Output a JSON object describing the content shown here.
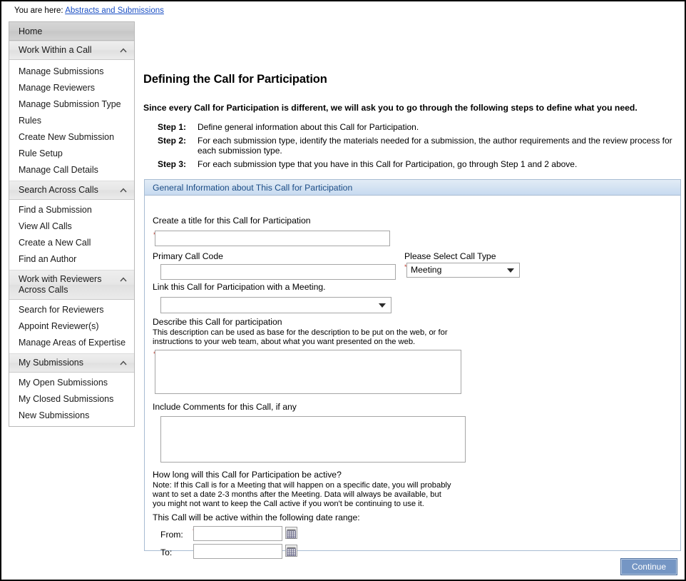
{
  "breadcrumb": {
    "label": "You are here:",
    "link": "Abstracts and Submissions"
  },
  "sidebar": {
    "home": "Home",
    "groups": [
      {
        "header": "Work Within a Call",
        "chevron_icon": "chevron-up-icon",
        "items": [
          "Manage Submissions",
          "Manage Reviewers",
          "Manage Submission Type",
          "Rules",
          "Create New Submission",
          "Rule Setup",
          "Manage Call Details"
        ]
      },
      {
        "header": "Search Across Calls",
        "chevron_icon": "chevron-up-icon",
        "items": [
          "Find a Submission",
          "View All Calls",
          "Create a New Call",
          "Find an Author"
        ]
      },
      {
        "header": "Work with Reviewers",
        "header_line2": "Across Calls",
        "chevron_icon": "chevron-up-icon",
        "items": [
          "Search for Reviewers",
          "Appoint Reviewer(s)",
          "Manage Areas of Expertise"
        ]
      },
      {
        "header": "My Submissions",
        "chevron_icon": "chevron-up-icon",
        "items": [
          "My Open Submissions",
          "My Closed Submissions",
          "New Submissions"
        ]
      }
    ]
  },
  "main": {
    "title": "Defining the Call for Participation",
    "intro": "Since every Call for Participation is different, we will ask you to go through the following steps to define what you need.",
    "steps": [
      {
        "label": "Step 1:",
        "text": "Define general information about this Call for Participation."
      },
      {
        "label": "Step 2:",
        "text": "For each submission type, identify the materials needed for a submission, the author requirements and the review process for each submission type."
      },
      {
        "label": "Step 3:",
        "text": "For each submission type that you have in this Call for Participation, go through Step 1 and 2 above."
      }
    ]
  },
  "panel": {
    "header": "General Information about This Call for Participation",
    "title_field": {
      "label": "Create a title for this Call for Participation",
      "value": "",
      "required_marker": "*"
    },
    "primary_call_code": {
      "label": "Primary Call Code",
      "value": ""
    },
    "call_type": {
      "label": "Please Select Call Type",
      "selected": "Meeting",
      "required_marker": "*",
      "arrow_icon": "chevron-down-icon"
    },
    "link_meeting": {
      "label": "Link this Call for Participation with a Meeting.",
      "selected": "",
      "arrow_icon": "chevron-down-icon"
    },
    "describe": {
      "label": "Describe this Call for participation",
      "help_line1": "This description can be used as base for the description to be put on the web, or for",
      "help_line2": "instructions to your web team, about what you want presented on the web.",
      "value": "",
      "required_marker": "*"
    },
    "comments": {
      "label": "Include Comments for this Call, if any",
      "value": ""
    },
    "duration": {
      "label": "How long will this Call for Participation be active?",
      "note_line1": "Note: If this Call is for a Meeting that will happen on a specific date, you will probably",
      "note_line2": "want to set a date 2-3 months after the Meeting. Data will always be available, but",
      "note_line3": "you might not want to keep the Call active if you won't be continuing to use it.",
      "range_label": "This Call will be active within the following date range:",
      "from_label": "From:",
      "from_value": "",
      "from_required_marker": "*",
      "to_label": "To:",
      "to_value": "",
      "calendar_icon": "calendar-icon"
    }
  },
  "footer": {
    "continue_label": "Continue"
  },
  "colors": {
    "link": "#1a4fc4",
    "panel_header_text": "#1c4d86",
    "panel_border": "#a8bcd2",
    "button_bg": "#7596c4",
    "required": "#c0392b"
  }
}
